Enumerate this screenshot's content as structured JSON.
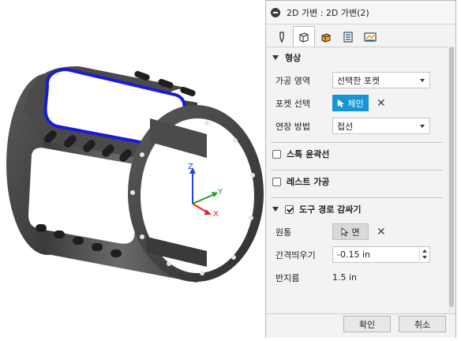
{
  "viewport": {
    "triad": {
      "x": "X",
      "y": "Y",
      "z": "Z"
    },
    "colors": {
      "body": "#555555",
      "selection": "#1a1adb",
      "x_axis": "#e02020",
      "y_axis": "#20a020",
      "z_axis": "#2040e0"
    }
  },
  "panel": {
    "title": "2D 가변 : 2D 가변(2)",
    "tabs": [
      {
        "name": "tool-icon"
      },
      {
        "name": "geometry-icon"
      },
      {
        "name": "heights-icon"
      },
      {
        "name": "passes-icon"
      },
      {
        "name": "linking-icon"
      }
    ],
    "sections": {
      "geometry": {
        "header": "형상",
        "machining_area": {
          "label": "가공 영역",
          "value": "선택한 포켓"
        },
        "pocket_selection": {
          "label": "포켓 선택",
          "button": "체인"
        },
        "extension_method": {
          "label": "연장 방법",
          "value": "접선"
        }
      },
      "stock_contours": {
        "header": "스톡 윤곽선"
      },
      "rest_machining": {
        "header": "레스트 가공"
      },
      "tool_path_reduction": {
        "header": "도구 경로 감싸기",
        "cylinder": {
          "label": "원통",
          "button": "면"
        },
        "offset": {
          "label": "간격띄우기",
          "value": "-0.15 in"
        },
        "radius": {
          "label": "반지름",
          "value": "1.5 in"
        }
      }
    },
    "footer": {
      "ok": "확인",
      "cancel": "취소"
    },
    "accent": "#1595d8"
  }
}
